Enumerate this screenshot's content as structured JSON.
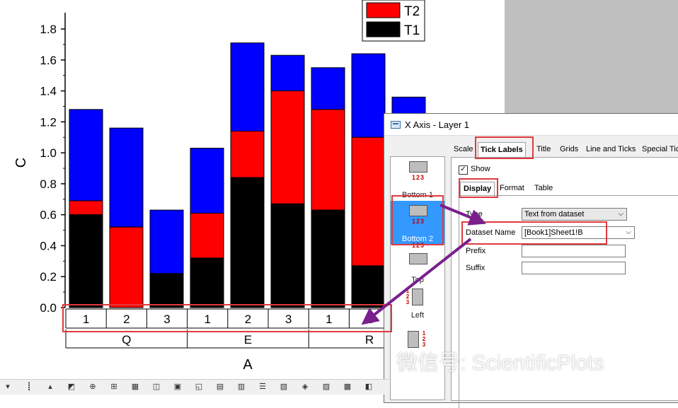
{
  "chart_data": {
    "type": "bar",
    "stacked": true,
    "ylabel": "C",
    "xlabel": "A",
    "ylim": [
      0,
      1.9
    ],
    "yticks": [
      "0.0",
      "0.2",
      "0.4",
      "0.6",
      "0.8",
      "1.0",
      "1.2",
      "1.4",
      "1.6",
      "1.8"
    ],
    "tick_labels": [
      "1",
      "2",
      "3",
      "1",
      "2",
      "3",
      "1",
      "2"
    ],
    "groups": [
      {
        "label": "Q",
        "span": 3
      },
      {
        "label": "E",
        "span": 3
      },
      {
        "label": "R",
        "span": 3
      }
    ],
    "legend": [
      "T2",
      "T1"
    ],
    "colors": {
      "T1": "#000000",
      "middle": "#ff0000",
      "top": "#0000ff"
    },
    "stacks": [
      {
        "T1": 0.6,
        "red": 0.69,
        "blue": 1.28
      },
      {
        "T1": 0.0,
        "red": 0.52,
        "blue": 1.16
      },
      {
        "T1": 0.22,
        "red": 0.22,
        "blue": 0.63
      },
      {
        "T1": 0.32,
        "red": 0.61,
        "blue": 1.03
      },
      {
        "T1": 0.84,
        "red": 1.14,
        "blue": 1.71
      },
      {
        "T1": 0.67,
        "red": 1.4,
        "blue": 1.63
      },
      {
        "T1": 0.63,
        "red": 1.28,
        "blue": 1.55
      },
      {
        "T1": 0.27,
        "red": 1.1,
        "blue": 1.64
      },
      {
        "T1": 0.0,
        "red": 0.0,
        "blue": 1.36
      }
    ]
  },
  "dialog": {
    "title": "X Axis - Layer 1",
    "tabs": [
      "Scale",
      "Tick Labels",
      "Title",
      "Grids",
      "Line and Ticks",
      "Special Tick"
    ],
    "left_items": [
      "Bottom 1",
      "Bottom 2",
      "Top",
      "Left"
    ],
    "tick_digits": "123",
    "show_label": "Show",
    "subtabs": [
      "Display",
      "Format",
      "Table"
    ],
    "type_label": "Type",
    "type_value": "Text from dataset",
    "dataset_label": "Dataset Name",
    "dataset_value": "[Book1]Sheet1!B",
    "prefix_label": "Prefix",
    "suffix_label": "Suffix"
  },
  "watermark": "微信号: ScientificPlots"
}
